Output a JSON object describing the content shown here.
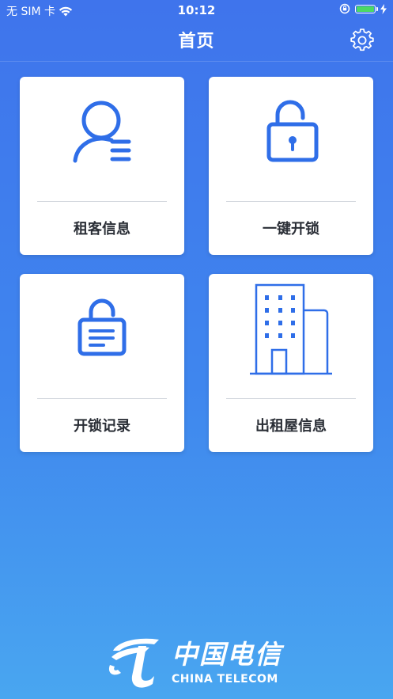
{
  "status_bar": {
    "carrier": "无 SIM 卡",
    "time": "10:12",
    "icons": [
      "wifi-icon",
      "orientation-lock-icon",
      "battery-icon",
      "charging-icon"
    ]
  },
  "nav": {
    "title": "首页",
    "settings_icon": "gear-icon"
  },
  "cards": [
    {
      "label": "租客信息",
      "icon": "tenant-user-icon"
    },
    {
      "label": "一键开锁",
      "icon": "unlock-padlock-icon"
    },
    {
      "label": "开锁记录",
      "icon": "unlock-record-icon"
    },
    {
      "label": "出租屋信息",
      "icon": "building-icon"
    }
  ],
  "footer": {
    "brand_cn": "中国电信",
    "brand_en": "CHINA TELECOM"
  },
  "colors": {
    "bg_top": "#3F74EC",
    "bg_bottom": "#49A6F0",
    "icon_blue": "#2F6EE8",
    "card_bg": "#FFFFFF",
    "label_text": "#2A2E36",
    "battery_green": "#4CD964"
  }
}
